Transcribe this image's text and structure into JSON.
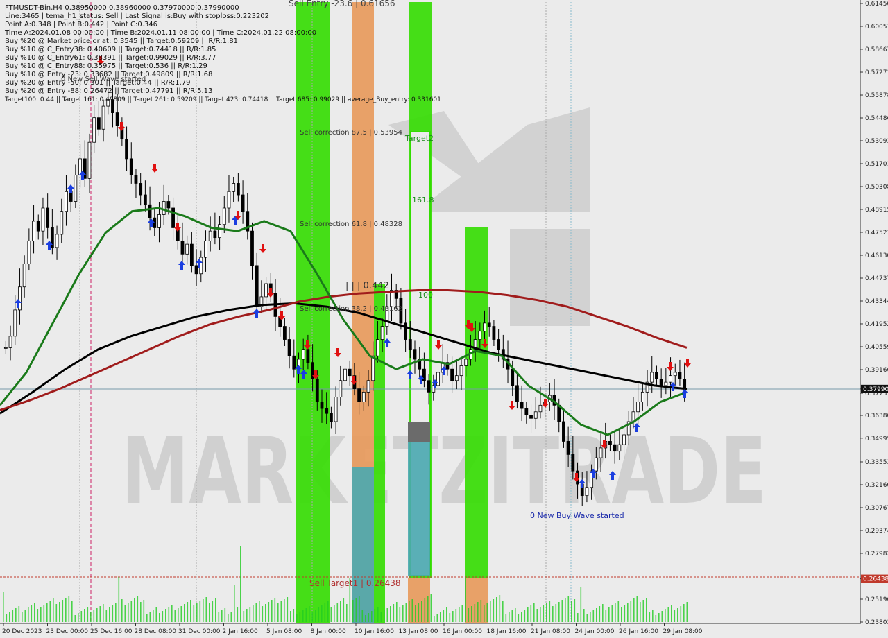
{
  "header": {
    "symbol_line": "FTMUSDT-Bin,H4  0.38950000 0.38960000 0.37970000 0.37990000",
    "lines": [
      "Line:3465 | tema_h1_status: Sell | Last Signal is:Buy with stoploss:0.223202",
      "Point A:0.348 | Point B:0.442 | Point C:0.346",
      "Time A:2024.01.08 00:00:00 | Time B:2024.01.11 08:00:00 | Time C:2024.01.22 08:00:00",
      "Buy %20 @ Market price or at: 0.3545 || Target:0.59209 || R/R:1.81",
      "Buy %10 @ C_Entry38: 0.40609 || Target:0.74418 || R/R:1.85",
      "Buy %10 @ C_Entry61: 0.38391 || Target:0.99029 || R/R:3.77",
      "Buy %10 @ C_Entry88: 0.35975 || Target:0.536 || R/R:1.29",
      "Buy %10 @ Entry -23: 0.33682 || Target:0.49809 || R/R:1.68",
      "Buy %20 @ Entry -50: 0.301 || Target:0.44 || R/R:1.79",
      "Buy %20 @ Entry -88: 0.26472 || Target:0.47791 || R/R:5.13",
      "Target100: 0.44 || Target 161: 0.49809 || Target 261: 0.59209 || Target 423: 0.74418 || Target 685: 0.99029 || average_Buy_entry: 0.331601"
    ]
  },
  "annotations": {
    "sell_entry": "Sell Entry -23.6 | 0.61656",
    "sell_correction_875": "Sell correction 87.5 | 0.53954",
    "sell_correction_618": "Sell correction 61.8 | 0.48328",
    "sell_correction_382": "Sell correction 38.2 | 0.43162",
    "sell_target1": "Sell Target1 | 0.26438",
    "point_b": "| | | 0.442",
    "target2": "Target2",
    "fib_161": "161.8",
    "fib_100": "100",
    "new_sell_wave": "0 New Sell Wave started",
    "new_buy_wave": "0 New Buy Wave started",
    "watermark": "MARKETZITRADE"
  },
  "colors": {
    "background": "#ebebeb",
    "green_bar": "#33dd00",
    "orange_bar": "#e8995a",
    "teal_bar": "#4aa9b0",
    "ma_green": "#1a7a1a",
    "ma_black": "#000000",
    "ma_red": "#a01c1c",
    "buy_arrow": "#1a3ee0",
    "sell_arrow": "#e01010",
    "volume": "#22cc22"
  },
  "chart_data": {
    "type": "candlestick",
    "ylim": [
      0.23803,
      0.6145
    ],
    "price_ticks": [
      "0.61450",
      "0.60057",
      "0.58667",
      "0.57271",
      "0.55878",
      "0.54486",
      "0.53093",
      "0.51701",
      "0.50308",
      "0.48915",
      "0.47523",
      "0.46130",
      "0.44737",
      "0.43344",
      "0.41952",
      "0.40559",
      "0.39166",
      "0.37990",
      "0.37731",
      "0.36380",
      "0.34995",
      "0.33553",
      "0.32160",
      "0.30767",
      "0.29374",
      "0.27982",
      "0.26438",
      "0.25196",
      "0.23803"
    ],
    "current_price": "0.37990",
    "target_price": "0.26438",
    "date_ticks": [
      "20 Dec 2023",
      "23 Dec 00:00",
      "25 Dec 16:00",
      "28 Dec 08:00",
      "31 Dec 00:00",
      "2 Jan 16:00",
      "5 Jan 08:00",
      "8 Jan 00:00",
      "10 Jan 16:00",
      "13 Jan 08:00",
      "16 Jan 00:00",
      "18 Jan 16:00",
      "21 Jan 08:00",
      "24 Jan 00:00",
      "26 Jan 16:00",
      "29 Jan 08:00"
    ],
    "close_path": [
      0.405,
      0.412,
      0.428,
      0.442,
      0.456,
      0.47,
      0.482,
      0.476,
      0.49,
      0.478,
      0.466,
      0.474,
      0.488,
      0.5,
      0.494,
      0.51,
      0.52,
      0.508,
      0.53,
      0.545,
      0.538,
      0.552,
      0.556,
      0.548,
      0.54,
      0.532,
      0.52,
      0.51,
      0.505,
      0.498,
      0.492,
      0.484,
      0.478,
      0.486,
      0.494,
      0.49,
      0.478,
      0.47,
      0.462,
      0.468,
      0.455,
      0.45,
      0.46,
      0.47,
      0.476,
      0.472,
      0.48,
      0.49,
      0.5,
      0.505,
      0.498,
      0.488,
      0.476,
      0.455,
      0.43,
      0.436,
      0.444,
      0.438,
      0.424,
      0.418,
      0.41,
      0.4,
      0.392,
      0.398,
      0.404,
      0.396,
      0.386,
      0.372,
      0.368,
      0.365,
      0.36,
      0.375,
      0.385,
      0.392,
      0.388,
      0.38,
      0.372,
      0.378,
      0.385,
      0.4,
      0.41,
      0.418,
      0.43,
      0.44,
      0.435,
      0.42,
      0.41,
      0.404,
      0.398,
      0.392,
      0.385,
      0.378,
      0.382,
      0.39,
      0.396,
      0.392,
      0.385,
      0.388,
      0.394,
      0.398,
      0.404,
      0.41,
      0.415,
      0.42,
      0.418,
      0.41,
      0.404,
      0.398,
      0.392,
      0.382,
      0.372,
      0.368,
      0.364,
      0.362,
      0.366,
      0.37,
      0.372,
      0.376,
      0.37,
      0.36,
      0.348,
      0.34,
      0.33,
      0.322,
      0.315,
      0.32,
      0.33,
      0.338,
      0.344,
      0.348,
      0.346,
      0.342,
      0.346,
      0.352,
      0.36,
      0.366,
      0.372,
      0.378,
      0.384,
      0.39,
      0.386,
      0.382,
      0.384,
      0.388,
      0.39,
      0.386,
      0.3799
    ],
    "series": [
      {
        "name": "",
        "values": [
          0.365,
          0.378,
          0.392,
          0.404,
          0.412,
          0.418,
          0.424,
          0.428,
          0.431,
          0.432,
          0.43,
          0.426,
          0.42,
          0.414,
          0.408,
          0.402,
          0.398,
          0.394,
          0.39,
          0.386,
          0.382,
          0.3799
        ]
      },
      {
        "name": "",
        "values": [
          0.367,
          0.373,
          0.38,
          0.388,
          0.396,
          0.404,
          0.412,
          0.419,
          0.424,
          0.428,
          0.433,
          0.436,
          0.438,
          0.439,
          0.44,
          0.44,
          0.439,
          0.437,
          0.434,
          0.43,
          0.424,
          0.418,
          0.411,
          0.405
        ]
      },
      {
        "name": "",
        "values": [
          0.37,
          0.39,
          0.42,
          0.45,
          0.475,
          0.488,
          0.49,
          0.485,
          0.478,
          0.476,
          0.482,
          0.476,
          0.45,
          0.422,
          0.4,
          0.392,
          0.398,
          0.395,
          0.403,
          0.4,
          0.382,
          0.372,
          0.358,
          0.352,
          0.36,
          0.372,
          0.378
        ]
      }
    ]
  }
}
